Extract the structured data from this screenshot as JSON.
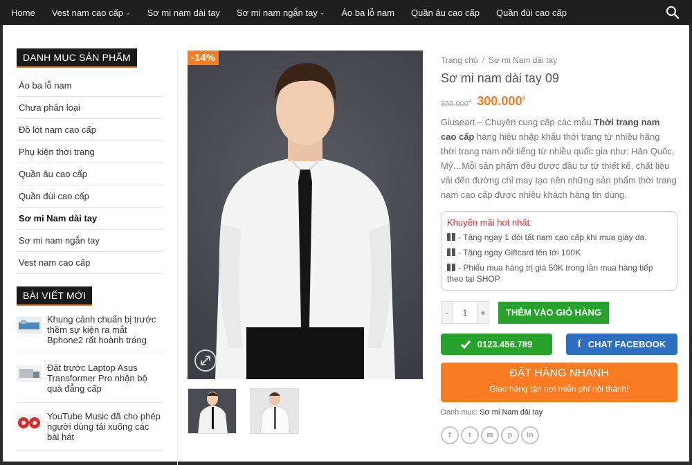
{
  "nav": {
    "items": [
      {
        "label": "Home",
        "dropdown": false
      },
      {
        "label": "Vest nam cao cấp",
        "dropdown": true
      },
      {
        "label": "Sơ mi nam dài tay",
        "dropdown": false
      },
      {
        "label": "Sơ mi nam ngắn tay",
        "dropdown": true
      },
      {
        "label": "Áo ba lỗ nam",
        "dropdown": false
      },
      {
        "label": "Quần âu cao cấp",
        "dropdown": false
      },
      {
        "label": "Quần đùi cao cấp",
        "dropdown": false
      }
    ]
  },
  "sidebar": {
    "categories_title": "DANH MỤC SẢN PHẨM",
    "categories": [
      "Áo ba lỗ nam",
      "Chưa phân loại",
      "Đồ lót nam cao cấp",
      "Phụ kiện thời trang",
      "Quần âu cao cấp",
      "Quần đùi cao cấp",
      "Sơ mi Nam dài tay",
      "Sơ mi nam ngắn tay",
      "Vest nam cao cấp"
    ],
    "active_category": "Sơ mi Nam dài tay",
    "posts_title": "BÀI VIẾT MỚI",
    "posts": [
      "Khung cảnh chuẩn bị trước thềm sự kiện ra mắt Bphone2 rất hoành tráng",
      "Đặt trước Laptop Asus Transformer Pro nhận bộ quà đẳng cấp",
      "YouTube Music đã cho phép người dùng tải xuống các bài hát"
    ]
  },
  "product": {
    "sale_badge": "-14%",
    "breadcrumb": [
      "Trang chủ",
      "Sơ mi Nam dài tay"
    ],
    "title": "Sơ mi nam dài tay 09",
    "old_price": "350.000",
    "new_price": "300.000",
    "currency": "₫",
    "desc_pre": "Giuseart – Chuyên cung cấp các mẫu ",
    "desc_bold": "Thời trang nam cao cấp",
    "desc_post": " hàng hiệu nhập khẩu thời trang từ nhiều hãng thời trang nam nổi tiếng từ nhiều quốc gia như: Hàn Quốc, Mỹ…Mỗi sản phẩm đều được đầu tư từ thiết kế, chất liệu vải đến đường chỉ may tạo nên những sản phẩm thời trang nam cao cấp được nhiều khách hàng tin dùng.",
    "promo_title": "Khuyến mãi hot nhất:",
    "promos": [
      "- Tặng ngay 1 đôi tất nam cao cấp khi mua giày da.",
      "- Tặng ngay Giftcard lên tới 100K",
      "- Phiếu mua hàng trị giá 50K trong lần mua hàng tiếp theo tại SHOP"
    ],
    "qty_minus": "-",
    "qty_value": "1",
    "qty_plus": "+",
    "add_to_cart": "THÊM VÀO GIỎ HÀNG",
    "phone": "0123.456.789",
    "chat_fb": "CHAT FACEBOOK",
    "order_now": "ĐẶT HÀNG NHANH",
    "order_sub": "Giao hàng tận nơi miễn phí nội thành!",
    "category_label": "Danh mục:",
    "category_value": "Sơ mi Nam dài tay"
  },
  "share_icons": [
    "facebook-icon",
    "twitter-icon",
    "email-icon",
    "pinterest-icon",
    "linkedin-icon"
  ],
  "colors": {
    "accent": "#f97b22",
    "green": "#27a32b",
    "facebook": "#2f6fc1",
    "promo_red": "#e8242b"
  }
}
